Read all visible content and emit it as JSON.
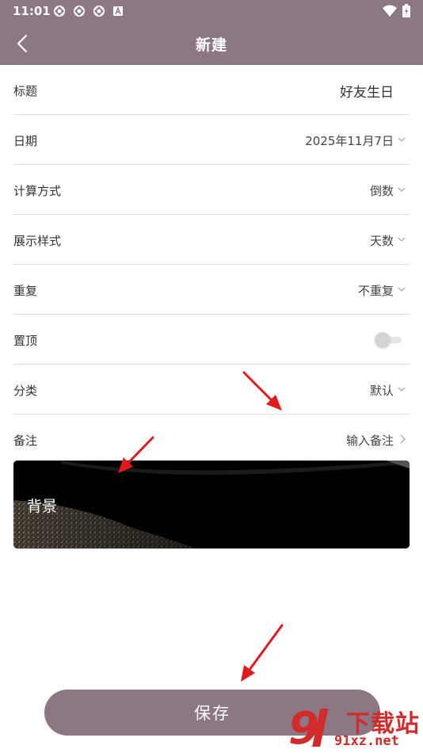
{
  "status_bar": {
    "time": "11:01",
    "notification_icons": [
      "app-notification-icon",
      "app-notification-icon",
      "app-notification-icon",
      "font-notification-icon"
    ],
    "right_icons": [
      "wifi-icon",
      "battery-charging-icon"
    ]
  },
  "header": {
    "title": "新建",
    "back_icon": "back-arrow-icon"
  },
  "form": {
    "title": {
      "label": "标题",
      "value": "好友生日"
    },
    "date": {
      "label": "日期",
      "value": "2025年11月7日"
    },
    "calc_method": {
      "label": "计算方式",
      "value": "倒数"
    },
    "display_style": {
      "label": "展示样式",
      "value": "天数"
    },
    "repeat": {
      "label": "重复",
      "value": "不重复"
    },
    "pin_top": {
      "label": "置顶",
      "enabled": false
    },
    "category": {
      "label": "分类",
      "value": "默认"
    },
    "note": {
      "label": "备注",
      "placeholder": "输入备注"
    }
  },
  "background": {
    "label": "背景"
  },
  "save_label": "保存",
  "watermark": {
    "line1": "下载站",
    "line2": "91xz.net"
  },
  "colors": {
    "primary": "#8c7784",
    "divider": "#dddddd",
    "annotation": "#e01b1b",
    "watermark": "#d22b2b"
  }
}
